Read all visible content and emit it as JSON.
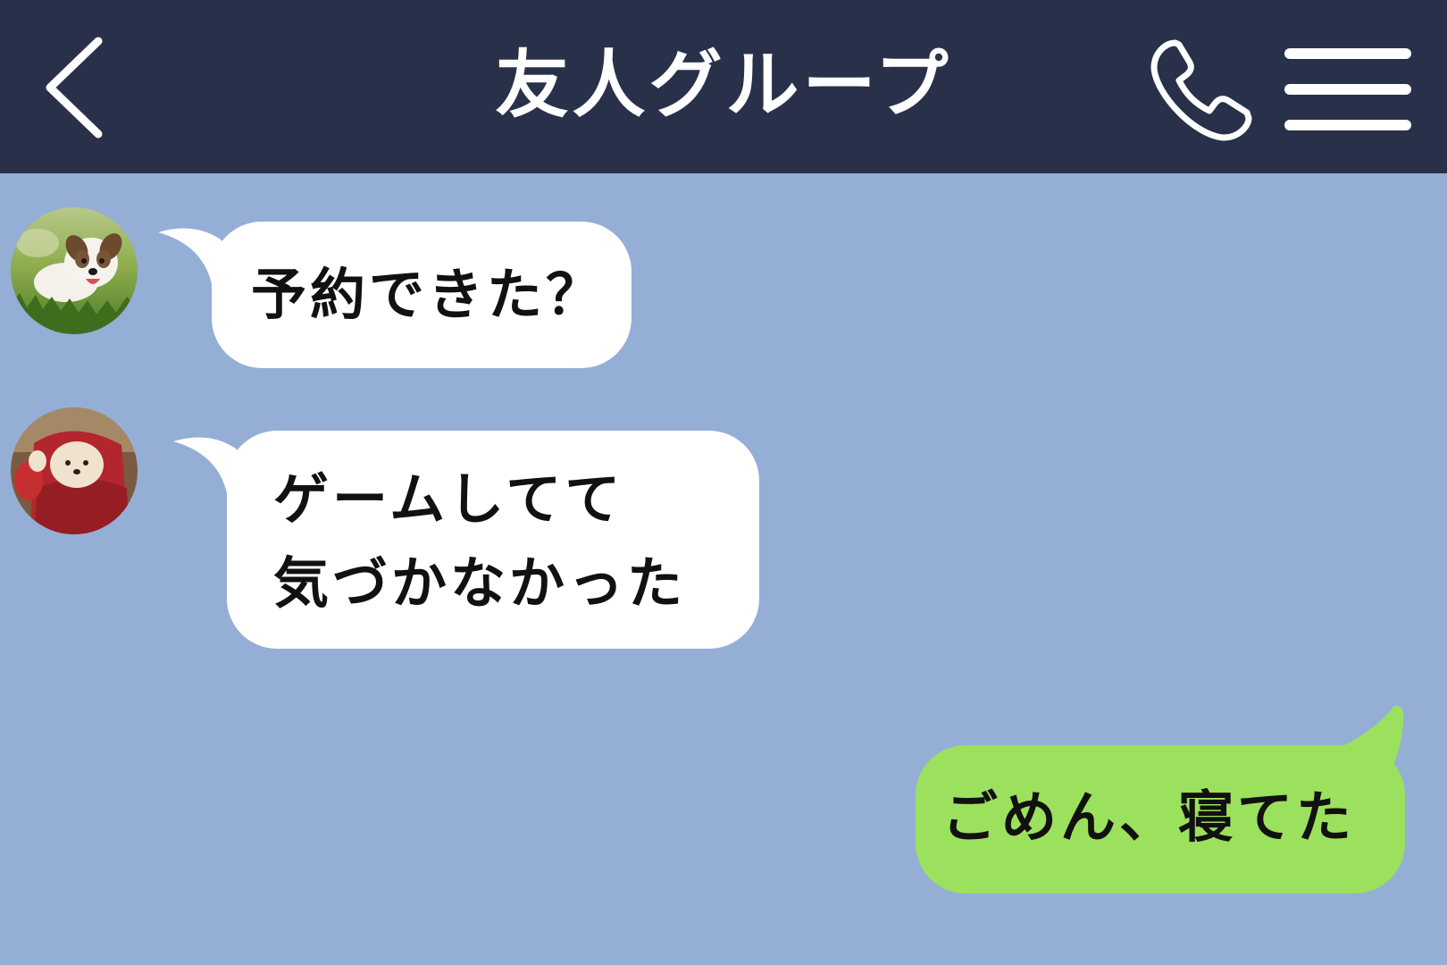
{
  "header": {
    "title": "友人グループ",
    "back_icon": "chevron-left-icon",
    "call_icon": "phone-icon",
    "menu_icon": "hamburger-menu-icon"
  },
  "colors": {
    "header_bg": "#283149",
    "chat_bg": "#95aed6",
    "incoming_bubble": "#ffffff",
    "outgoing_bubble": "#9be15d"
  },
  "messages": [
    {
      "direction": "incoming",
      "avatar": "puppy-photo-avatar",
      "text": "予約できた？"
    },
    {
      "direction": "incoming",
      "avatar": "knitted-doll-photo-avatar",
      "text": "ゲームしてて\n気づかなかった"
    },
    {
      "direction": "outgoing",
      "text": "ごめん、寝てた"
    }
  ]
}
